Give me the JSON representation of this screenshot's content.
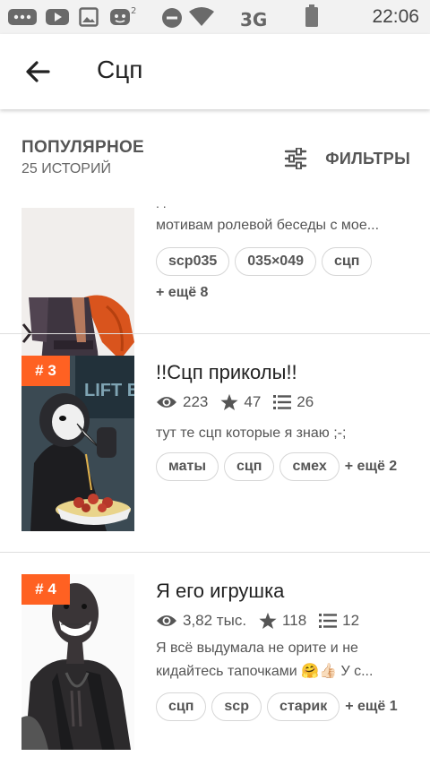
{
  "status_bar": {
    "time": "22:06",
    "network": "3G"
  },
  "app_bar": {
    "title": "Сцп"
  },
  "section": {
    "title": "ПОПУЛЯРНОЕ",
    "count": "25 ИСТОРИЙ",
    "filters_label": "ФИЛЬТРЫ"
  },
  "stories": [
    {
      "description_fragment": ". .",
      "description": "мотивам ролевой беседы с мое...",
      "tags": [
        "scp035",
        "035×049",
        "сцп"
      ],
      "more": "+ ещё 8"
    },
    {
      "rank": "# 3",
      "title": "!!Сцп приколы!!",
      "views": "223",
      "stars": "47",
      "parts": "26",
      "description": "тут те сцп которые я знаю ;-;",
      "tags": [
        "маты",
        "сцп",
        "смех"
      ],
      "more": "+ ещё 2",
      "cover_text": "LIFT B"
    },
    {
      "rank": "# 4",
      "title": "Я его игрушка",
      "views": "3,82 тыс.",
      "stars": "118",
      "parts": "12",
      "description_line1": "Я всё выдумала не орите и не",
      "description_line2": "кидайтесь тапочками 🤗👍🏻 У с...",
      "tags": [
        "сцп",
        "scp",
        "старик"
      ],
      "more": "+ ещё 1"
    }
  ],
  "colors": {
    "accent": "#ff6122",
    "text": "#222222",
    "muted": "#555555"
  }
}
